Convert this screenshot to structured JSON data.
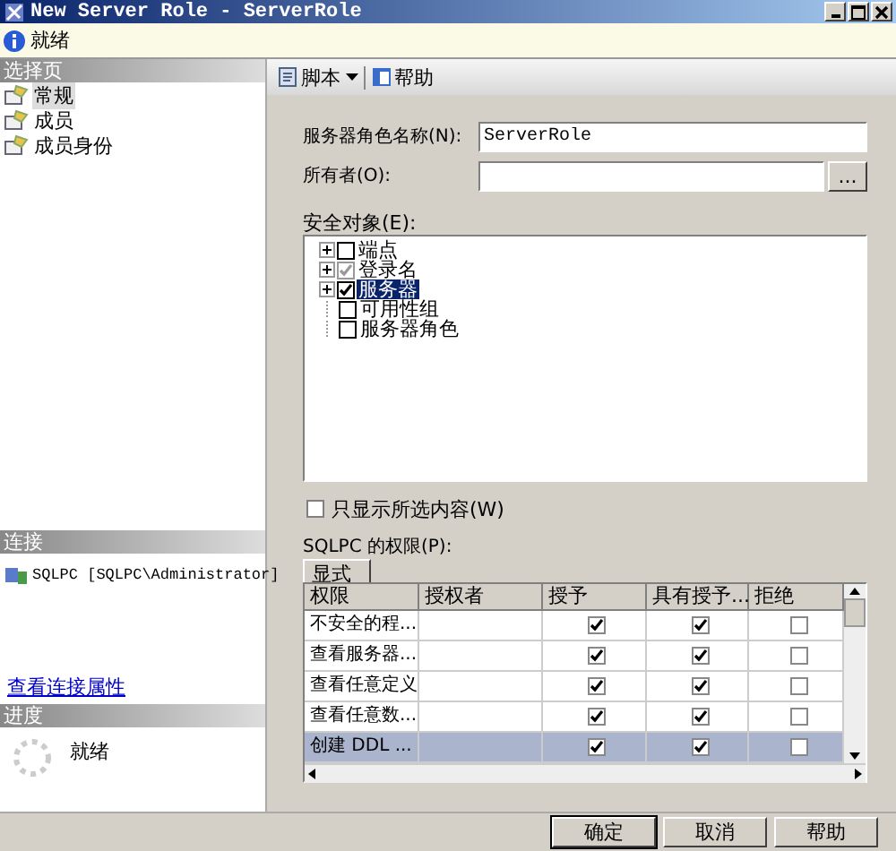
{
  "window": {
    "title": "New Server Role - ServerRole"
  },
  "status": {
    "text": "就绪"
  },
  "sidebar": {
    "header": "选择页",
    "items": [
      {
        "label": "常规",
        "selected": true
      },
      {
        "label": "成员",
        "selected": false
      },
      {
        "label": "成员身份",
        "selected": false
      }
    ]
  },
  "connection": {
    "header": "连接",
    "server": "SQLPC [SQLPC\\Administrator]",
    "link": "查看连接属性"
  },
  "progress": {
    "header": "进度",
    "text": "就绪"
  },
  "toolbar": {
    "script": "脚本",
    "help": "帮助"
  },
  "form": {
    "name_label": "服务器角色名称(N):",
    "name_value": "ServerRole",
    "owner_label": "所有者(O):",
    "browse": "..."
  },
  "securables": {
    "label": "安全对象(E):",
    "items": [
      {
        "label": "端点",
        "expandable": true,
        "checked": false,
        "greyed": false,
        "selected": false
      },
      {
        "label": "登录名",
        "expandable": true,
        "checked": true,
        "greyed": true,
        "selected": false
      },
      {
        "label": "服务器",
        "expandable": true,
        "checked": true,
        "greyed": false,
        "selected": true
      },
      {
        "label": "可用性组",
        "expandable": false,
        "checked": false,
        "greyed": false,
        "selected": false
      },
      {
        "label": "服务器角色",
        "expandable": false,
        "checked": false,
        "greyed": false,
        "selected": false
      }
    ]
  },
  "show_selected": {
    "label": "只显示所选内容(W)",
    "checked": false
  },
  "permissions": {
    "label": "SQLPC 的权限(P):",
    "tabs": [
      {
        "label": "显式",
        "selected": true
      }
    ],
    "columns": [
      "权限",
      "授权者",
      "授予",
      "具有授予...",
      "拒绝"
    ],
    "rows": [
      {
        "permission": "不安全的程...",
        "grant": true,
        "with_grant": true,
        "deny": false,
        "selected": false
      },
      {
        "permission": "查看服务器...",
        "grant": true,
        "with_grant": true,
        "deny": false,
        "selected": false
      },
      {
        "permission": "查看任意定义",
        "grant": true,
        "with_grant": true,
        "deny": false,
        "selected": false
      },
      {
        "permission": "查看任意数...",
        "grant": true,
        "with_grant": true,
        "deny": false,
        "selected": false
      },
      {
        "permission": "创建 DDL ...",
        "grant": true,
        "with_grant": true,
        "deny": false,
        "selected": true
      }
    ]
  },
  "buttons": [
    "确定",
    "取消",
    "帮助"
  ]
}
